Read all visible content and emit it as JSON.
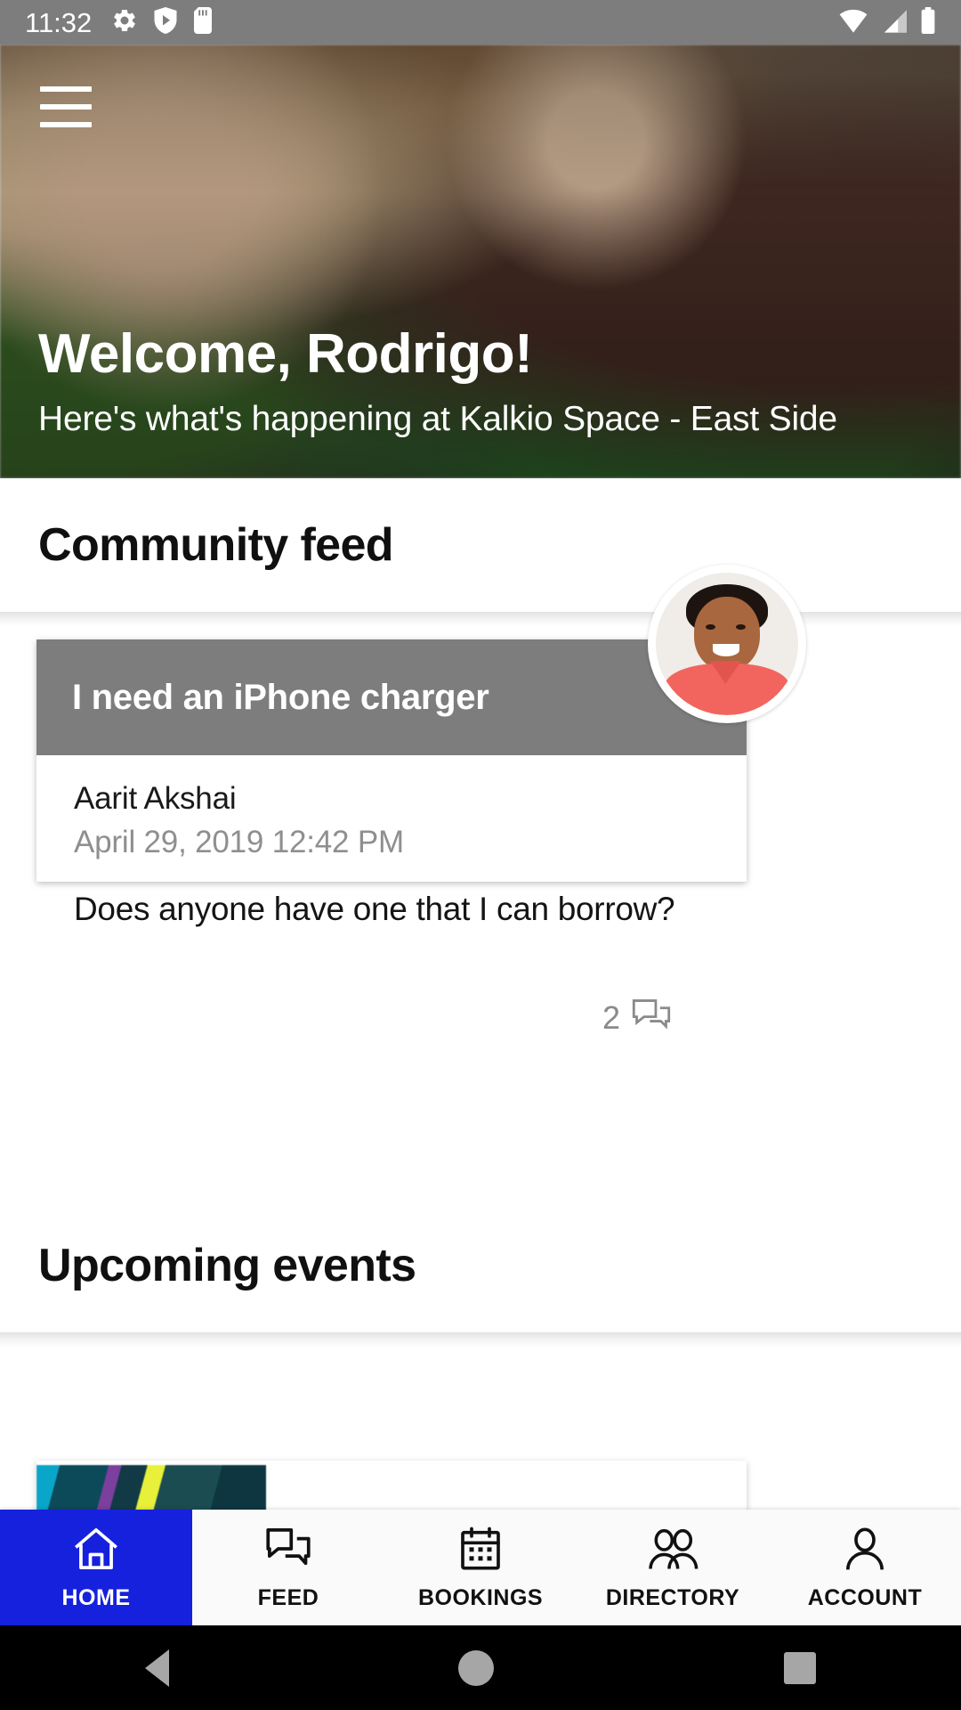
{
  "status_bar": {
    "time": "11:32",
    "left_icons": [
      "gear-icon",
      "shield-play-icon",
      "sd-card-icon"
    ],
    "right_icons": [
      "wifi-icon",
      "cell-signal-icon",
      "battery-icon"
    ],
    "background_color": "#7d7d7d"
  },
  "hero": {
    "menu_icon": "hamburger-menu-icon",
    "title": "Welcome, Rodrigo!",
    "subtitle": "Here's what's happening at Kalkio Space - East Side"
  },
  "community": {
    "heading": "Community feed",
    "post": {
      "title": "I need an iPhone charger",
      "author": "Aarit Akshai",
      "timestamp": "April 29, 2019 12:42 PM",
      "body": "Does anyone have one that I can borrow?",
      "comment_count": "2",
      "comment_icon": "comment-bubbles-icon",
      "avatar": "user-avatar",
      "header_color": "#7d7d7d"
    }
  },
  "upcoming": {
    "heading": "Upcoming events"
  },
  "bottom_nav": {
    "active_color": "#1621de",
    "items": [
      {
        "label": "HOME",
        "icon": "home-icon",
        "active": true
      },
      {
        "label": "FEED",
        "icon": "chat-bubbles-icon",
        "active": false
      },
      {
        "label": "BOOKINGS",
        "icon": "calendar-icon",
        "active": false
      },
      {
        "label": "DIRECTORY",
        "icon": "people-group-icon",
        "active": false
      },
      {
        "label": "ACCOUNT",
        "icon": "person-icon",
        "active": false
      }
    ]
  },
  "android_nav": {
    "back": "back-triangle-icon",
    "home": "home-circle-icon",
    "recents": "recents-square-icon"
  }
}
